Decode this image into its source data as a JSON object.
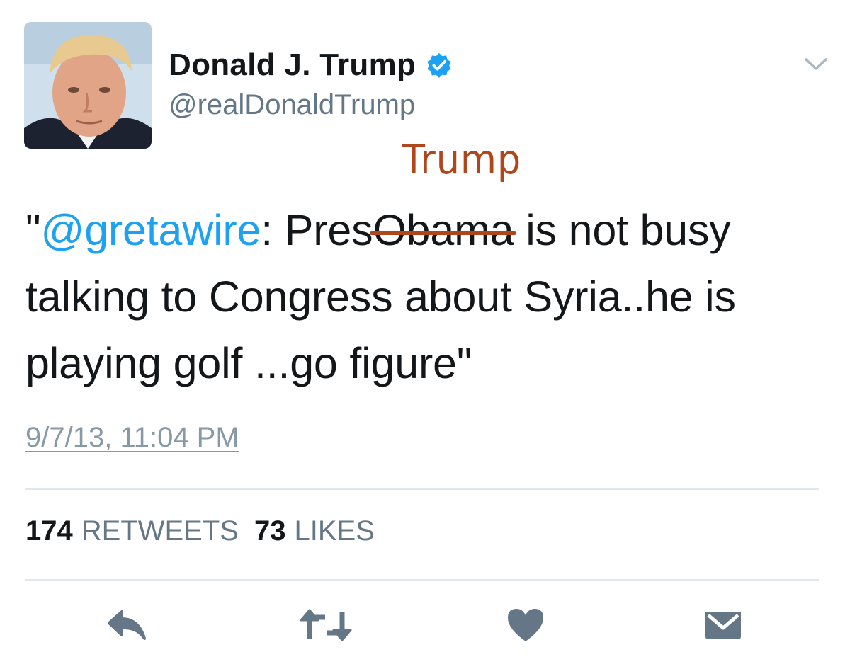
{
  "author": {
    "display_name": "Donald J. Trump",
    "handle": "@realDonaldTrump",
    "verified_icon": "verified-badge-icon",
    "avatar": "profile-photo"
  },
  "annotation": {
    "text": "Trump",
    "color": "#b0461b"
  },
  "tweet": {
    "open_quote": "\"",
    "mention": "@gretawire",
    "after_mention": ": Pres",
    "struck_word": "Obama",
    "line1_rest": " is not busy",
    "line2": "talking to Congress about Syria..he is",
    "line3": "playing golf ...go figure\""
  },
  "timestamp": "9/7/13, 11:04 PM",
  "stats": {
    "retweets_count": "174",
    "retweets_label": "RETWEETS",
    "likes_count": "73",
    "likes_label": "LIKES"
  },
  "actions": [
    {
      "name": "reply-icon"
    },
    {
      "name": "retweet-icon"
    },
    {
      "name": "like-heart-icon"
    },
    {
      "name": "direct-message-icon"
    }
  ],
  "colors": {
    "text": "#14171a",
    "secondary": "#657786",
    "link": "#1da1f2",
    "icon": "#657786",
    "divider": "#e1e8ed"
  }
}
